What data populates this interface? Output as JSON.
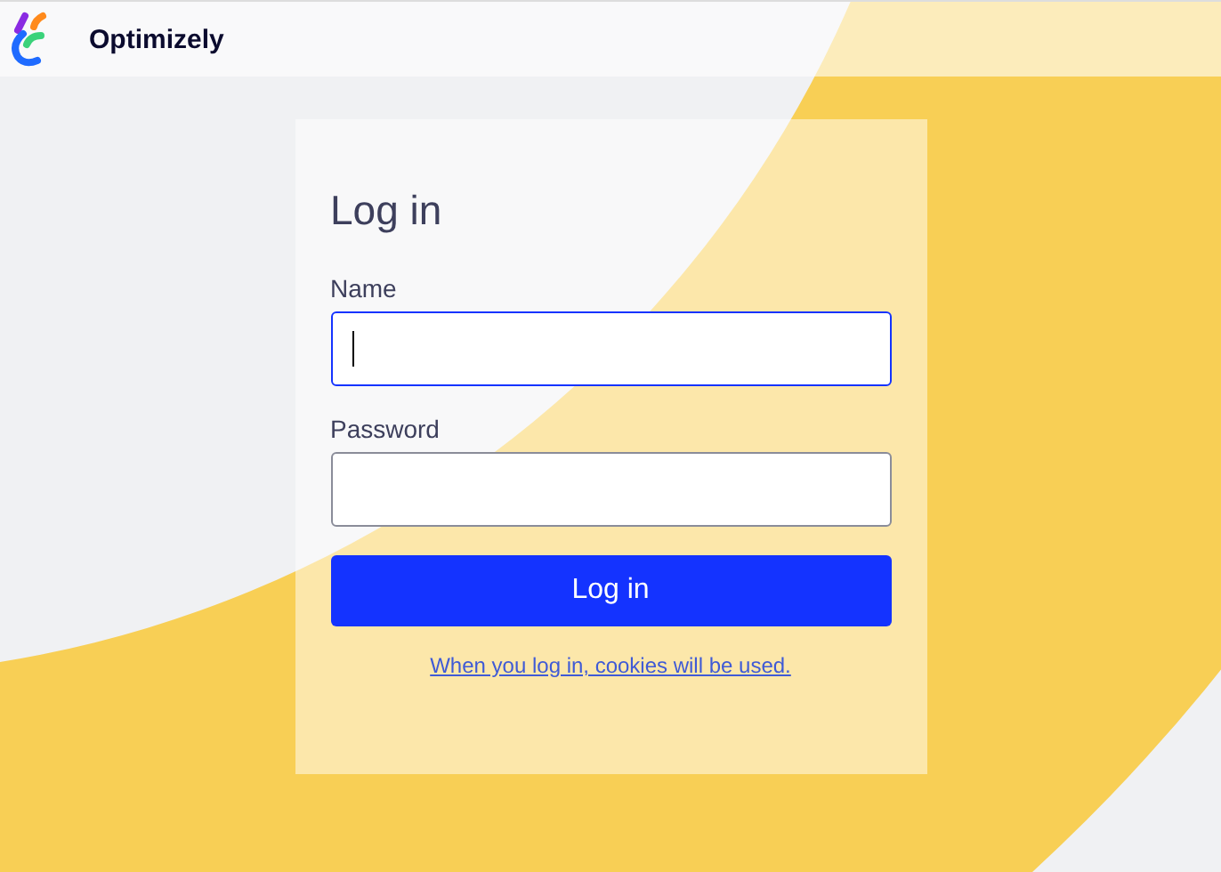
{
  "header": {
    "brand": "Optimizely"
  },
  "login": {
    "title": "Log in",
    "fields": [
      {
        "label": "Name",
        "focused": true
      },
      {
        "label": "Password",
        "focused": false
      }
    ],
    "submit": "Log in",
    "notice_link": "When you log in, cookies will be used."
  }
}
